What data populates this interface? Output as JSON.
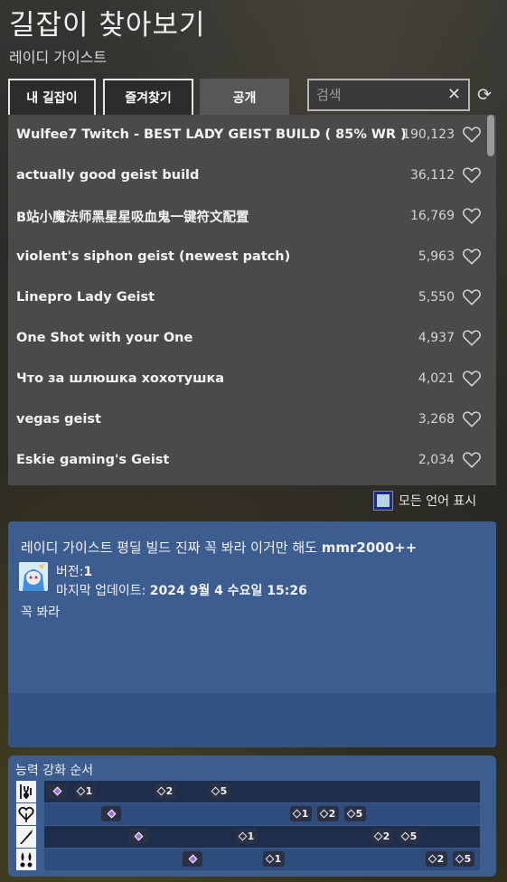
{
  "header": {
    "title": "길잡이 찾아보기",
    "subtitle": "레이디 가이스트"
  },
  "tabs": [
    {
      "label": "내 길잡이",
      "active": false
    },
    {
      "label": "즐겨찾기",
      "active": false
    },
    {
      "label": "공개",
      "active": true
    }
  ],
  "search": {
    "placeholder": "검색",
    "value": "",
    "clear_icon": "close-icon",
    "refresh_icon": "refresh-icon"
  },
  "builds": [
    {
      "name": "Wulfee7 Twitch - BEST LADY GEIST BUILD ( 85% WR )",
      "count": "190,123"
    },
    {
      "name": "actually good geist build",
      "count": "36,112"
    },
    {
      "name": "B站小魔法师黑星星吸血鬼一键符文配置",
      "count": "16,769"
    },
    {
      "name": "violent's siphon geist (newest patch)",
      "count": "5,963"
    },
    {
      "name": "Linepro Lady Geist",
      "count": "5,550"
    },
    {
      "name": "One Shot with your One",
      "count": "4,937"
    },
    {
      "name": "Что за шлюшка хохотушка",
      "count": "4,021"
    },
    {
      "name": "vegas geist",
      "count": "3,268"
    },
    {
      "name": "Eskie gaming's Geist",
      "count": "2,034"
    }
  ],
  "show_all_languages": {
    "label": "모든 언어 표시",
    "checked": true
  },
  "selected_build": {
    "title": "레이디 가이스트 평딜 빌드 진짜 꼭 봐라 이거만 해도",
    "title_bold": "mmr2000++",
    "version_label": "버전:",
    "version_value": "1",
    "updated_label": "마지막 업데이트:",
    "updated_value": "2024 9월 4 수요일 15:26",
    "description": "꼭 봐라"
  },
  "ability_order": {
    "heading": "능력 강화 순서",
    "rows": [
      {
        "icon": "essence-bomb-icon",
        "chips": [
          {
            "slot": 0,
            "label": ""
          },
          {
            "slot": 1,
            "label": "1"
          },
          {
            "slot": 4,
            "label": "2"
          },
          {
            "slot": 6,
            "label": "5"
          }
        ]
      },
      {
        "icon": "life-drain-icon",
        "chips": [
          {
            "slot": 2,
            "label": ""
          },
          {
            "slot": 9,
            "label": "1"
          },
          {
            "slot": 10,
            "label": "2"
          },
          {
            "slot": 11,
            "label": "5"
          }
        ]
      },
      {
        "icon": "malice-icon",
        "chips": [
          {
            "slot": 3,
            "label": ""
          },
          {
            "slot": 7,
            "label": "1"
          },
          {
            "slot": 12,
            "label": "2"
          },
          {
            "slot": 13,
            "label": "5"
          }
        ]
      },
      {
        "icon": "soul-exchange-icon",
        "chips": [
          {
            "slot": 5,
            "label": ""
          },
          {
            "slot": 8,
            "label": "1"
          },
          {
            "slot": 14,
            "label": "2"
          },
          {
            "slot": 15,
            "label": "5"
          }
        ]
      }
    ]
  }
}
